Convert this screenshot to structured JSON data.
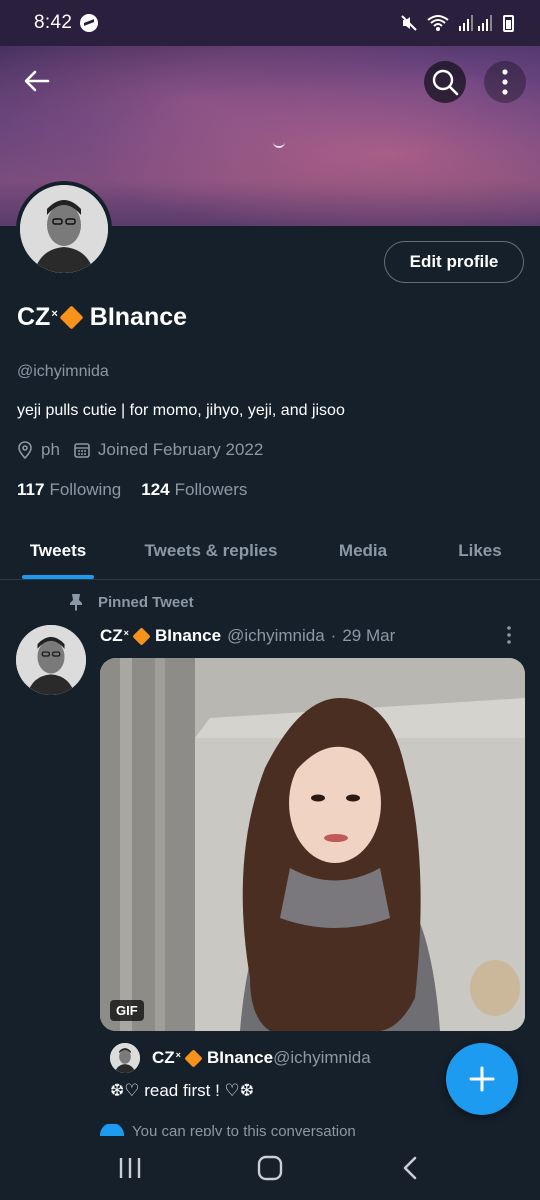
{
  "status_bar": {
    "time": "8:42",
    "icons": [
      "messenger-icon",
      "mute-icon",
      "wifi-icon",
      "signal-icon",
      "battery-icon"
    ]
  },
  "header": {
    "back_icon": "arrow-left-icon",
    "search_icon": "search-icon",
    "more_icon": "more-vertical-icon"
  },
  "profile": {
    "edit_button": "Edit profile",
    "name_prefix": "CZ",
    "name_x": "×",
    "name_suffix": "BInance",
    "handle": "@ichyimnida",
    "bio": "yeji pulls cutie | for momo, jihyo, yeji, and jisoo",
    "location": "ph",
    "joined": "Joined February 2022",
    "following_count": "117",
    "following_label": "Following",
    "followers_count": "124",
    "followers_label": "Followers"
  },
  "tabs": [
    {
      "label": "Tweets",
      "active": true
    },
    {
      "label": "Tweets & replies",
      "active": false
    },
    {
      "label": "Media",
      "active": false
    },
    {
      "label": "Likes",
      "active": false
    }
  ],
  "tweet": {
    "pinned_label": "Pinned Tweet",
    "name_prefix": "CZ",
    "name_x": "×",
    "name_suffix": "BInance",
    "handle": "@ichyimnida",
    "dot": "·",
    "date": "29 Mar",
    "gif_badge": "GIF",
    "quote": {
      "name_prefix": "CZ",
      "name_x": "×",
      "name_suffix": "BInance",
      "handle": "@ichyimnida",
      "text": "❆♡ read first ! ♡❆"
    },
    "reply_note": "You can reply to this conversation"
  },
  "colors": {
    "background": "#15202b",
    "accent": "#1d9bf0",
    "muted_text": "#8b98a5",
    "diamond": "#f7931a"
  },
  "nav": {
    "recents_icon": "recents-icon",
    "home_icon": "home-icon",
    "back_icon": "back-chevron-icon"
  }
}
